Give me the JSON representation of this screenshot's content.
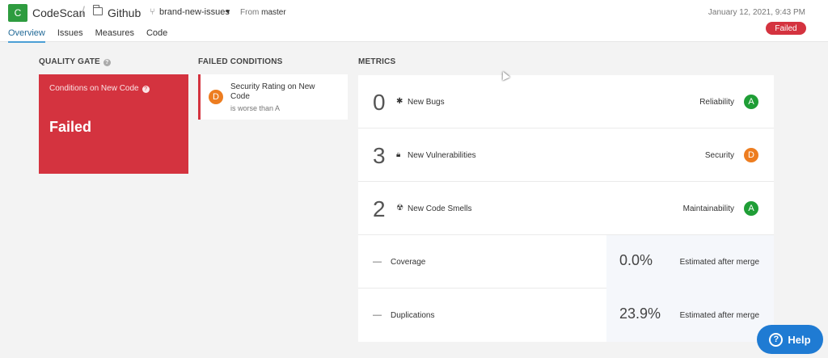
{
  "header": {
    "logo_letter": "C",
    "org": "CodeScan",
    "separator": "/",
    "repo": "Github",
    "branch": "brand-new-issues",
    "from_label": "From",
    "from_branch": "master",
    "date": "January 12, 2021, 9:43 PM",
    "status": "Failed"
  },
  "nav": {
    "tabs": [
      {
        "label": "Overview",
        "active": true
      },
      {
        "label": "Issues"
      },
      {
        "label": "Measures"
      },
      {
        "label": "Code"
      }
    ]
  },
  "quality_gate": {
    "title": "QUALITY GATE",
    "subtitle": "Conditions on New Code",
    "status": "Failed",
    "color": "#d4333f"
  },
  "failed_conditions": {
    "title": "FAILED CONDITIONS",
    "items": [
      {
        "rating": "D",
        "metric": "Security Rating on New Code",
        "detail": "is worse than A"
      }
    ]
  },
  "metrics": {
    "title": "METRICS",
    "rows": [
      {
        "value": "0",
        "icon": "bug-icon",
        "label": "New Bugs",
        "category": "Reliability",
        "rating": "A"
      },
      {
        "value": "3",
        "icon": "lock-icon",
        "label": "New Vulnerabilities",
        "category": "Security",
        "rating": "D"
      },
      {
        "value": "2",
        "icon": "code-smell-icon",
        "label": "New Code Smells",
        "category": "Maintainability",
        "rating": "A"
      }
    ],
    "extra": [
      {
        "dash": "—",
        "label": "Coverage",
        "value": "0.0%",
        "note": "Estimated after merge"
      },
      {
        "dash": "—",
        "label": "Duplications",
        "value": "23.9%",
        "note": "Estimated after merge"
      }
    ]
  },
  "help": {
    "icon": "?",
    "label": "Help"
  },
  "colors": {
    "accent": "#4b9fd5",
    "rating_a": "#1f9e36",
    "rating_d": "#ed7d20",
    "help": "#1f7bd3"
  }
}
